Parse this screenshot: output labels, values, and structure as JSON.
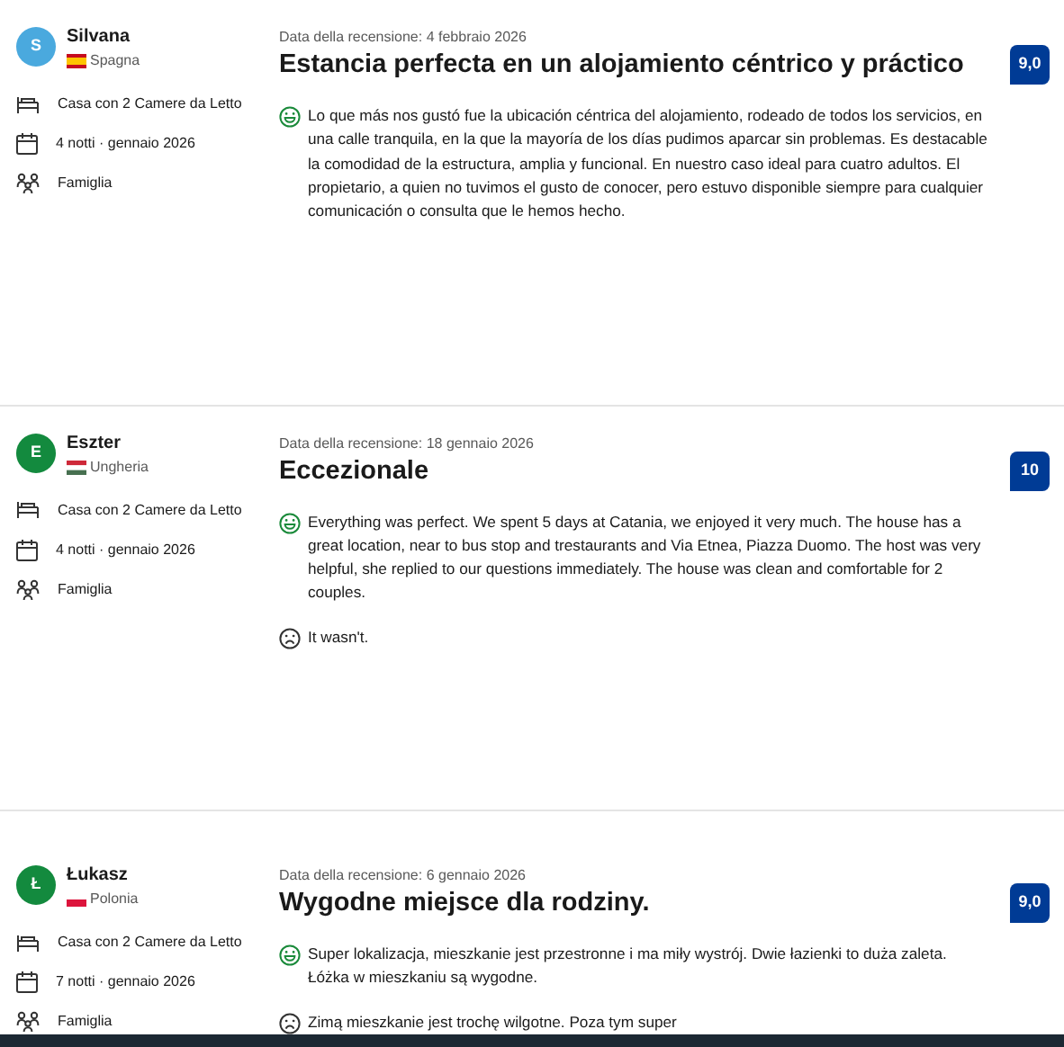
{
  "reviews": [
    {
      "avatar": {
        "letter": "S",
        "color": "#4aa9de"
      },
      "name": "Silvana",
      "country": {
        "kind": "es",
        "name": "Spagna"
      },
      "room": "Casa con 2 Camere da Letto",
      "stay": "4 notti · gennaio 2026",
      "traveler": "Famiglia",
      "date": "Data della recensione: 4 febbraio 2026",
      "title": "Estancia perfecta en un alojamiento céntrico y práctico",
      "score": "9,0",
      "positive": "Lo que más nos gustó fue la ubicación céntrica del alojamiento, rodeado de todos los servicios, en una calle tranquila, en la que la mayoría de los días pudimos aparcar sin problemas. Es destacable la comodidad de la estructura, amplia y funcional. En nuestro caso ideal para cuatro adultos. El propietario, a quien no tuvimos el gusto de conocer, pero estuvo disponible siempre para cualquier comunicación o consulta que le hemos hecho."
    },
    {
      "avatar": {
        "letter": "E",
        "color": "#138a3e"
      },
      "name": "Eszter",
      "country": {
        "kind": "hu",
        "name": "Ungheria"
      },
      "room": "Casa con 2 Camere da Letto",
      "stay": "4 notti · gennaio 2026",
      "traveler": "Famiglia",
      "date": "Data della recensione: 18 gennaio 2026",
      "title": "Eccezionale",
      "score": "10",
      "positive": "Everything was perfect. We spent 5 days at Catania, we enjoyed it very much. The house has a great location, near to bus stop and trestaurants and Via Etnea, Piazza Duomo. The host was very helpful, she replied to our questions immediately. The house was clean and comfortable for 2 couples.",
      "negative": "It wasn't."
    },
    {
      "avatar": {
        "letter": "Ł",
        "color": "#138a3e"
      },
      "name": "Łukasz",
      "country": {
        "kind": "pl",
        "name": "Polonia"
      },
      "room": "Casa con 2 Camere da Letto",
      "stay": "7 notti · gennaio 2026",
      "traveler": "Famiglia",
      "date": "Data della recensione: 6 gennaio 2026",
      "title": "Wygodne miejsce dla rodziny.",
      "score": "9,0",
      "positive": "Super lokalizacja, mieszkanie jest przestronne i ma miły wystrój. Dwie łazienki to duża zaleta. Łóżka w mieszkaniu są wygodne.",
      "negative": "Zimą mieszkanie jest trochę wilgotne. Poza tym super"
    }
  ]
}
